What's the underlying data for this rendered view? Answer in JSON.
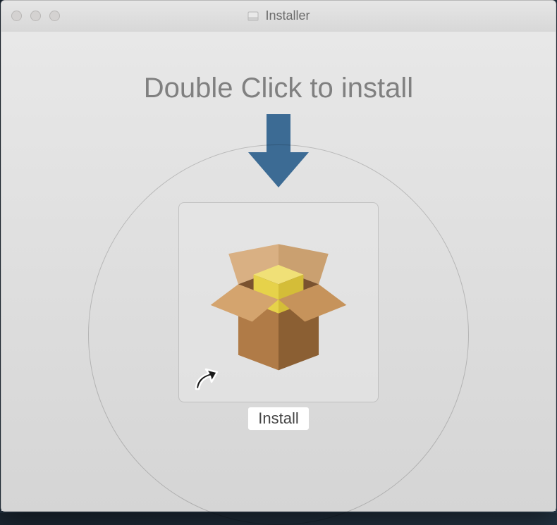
{
  "window": {
    "title": "Installer",
    "instruction": "Double Click to install",
    "install_label": "Install"
  },
  "icons": {
    "disk": "disk-icon",
    "arrow": "down-arrow-icon",
    "package": "package-box-icon",
    "shortcut": "shortcut-arrow-icon"
  },
  "colors": {
    "arrow": "#3c6b94",
    "box_side": "#b07b47",
    "box_side_dark": "#8b5f33",
    "flap": "#c99865",
    "cube": "#e6d24a",
    "cube_top": "#f0e077"
  }
}
